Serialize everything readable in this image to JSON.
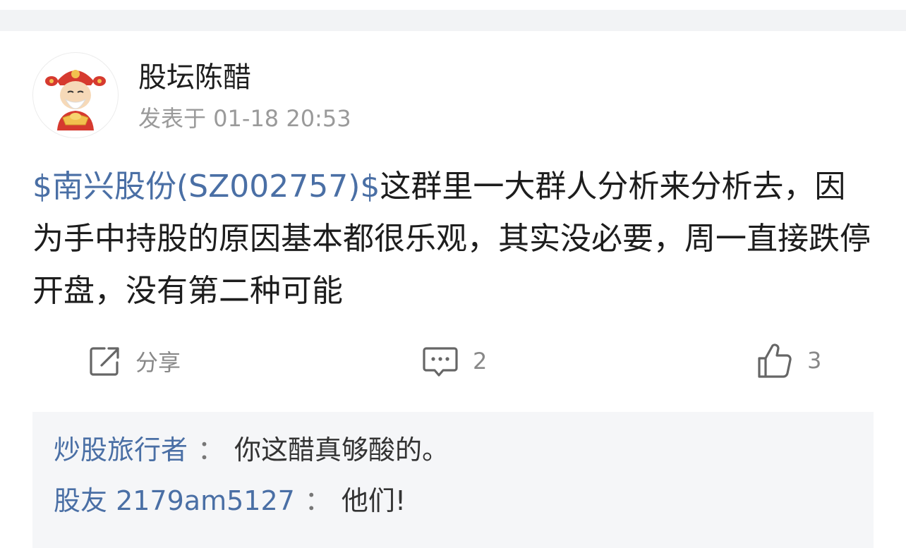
{
  "post": {
    "author": "股坛陈醋",
    "time": "发表于 01-18 20:53",
    "stock_tag": "$南兴股份(SZ002757)$",
    "text": "这群里一大群人分析来分析去，因为手中持股的原因基本都很乐观，其实没必要，周一直接跌停开盘，没有第二种可能"
  },
  "actions": {
    "share_label": "分享",
    "comment_count": "2",
    "like_count": "3"
  },
  "comments": [
    {
      "user": "炒股旅行者",
      "sep": "：",
      "text": "你这醋真够酸的。"
    },
    {
      "user": "股友 2179am5127",
      "sep": "：",
      "text": "他们!"
    }
  ],
  "colors": {
    "link": "#4a6fa5",
    "text": "#1d1d1d",
    "muted": "#9a9a9a",
    "comment_bg": "#f5f6f8"
  },
  "icons": {
    "avatar": "caishen-god-of-wealth-avatar",
    "share": "share-icon",
    "comment": "comment-icon",
    "like": "thumbs-up-icon"
  }
}
